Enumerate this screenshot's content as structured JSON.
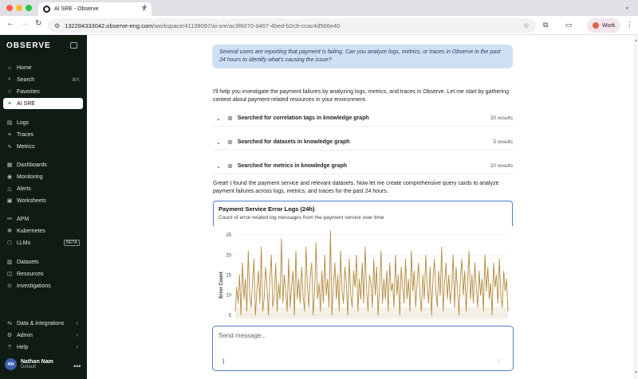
{
  "browser": {
    "tab_title": "AI SRE - Observe",
    "new_tab": "+",
    "url_host": "132284333042.observe-eng.com",
    "url_path": "/workspace/41139097/ai-sre/ac3f6070-d467-4bed-b2c9-ccac4d566e40",
    "profile_label": "Work"
  },
  "sidebar": {
    "logo": "OBSERVE",
    "items": [
      {
        "label": "Home",
        "icon": "home-icon",
        "glyph": "⌂"
      },
      {
        "label": "Search",
        "icon": "search-icon",
        "glyph": "⌕",
        "hint": "⌘K"
      },
      {
        "label": "Favorites",
        "icon": "star-icon",
        "glyph": "☆"
      },
      {
        "label": "AI SRE",
        "icon": "sparkle-icon",
        "glyph": "✦"
      },
      {
        "label": "Logs",
        "icon": "logs-icon",
        "glyph": "▤"
      },
      {
        "label": "Traces",
        "icon": "traces-icon",
        "glyph": "≡"
      },
      {
        "label": "Metrics",
        "icon": "metrics-icon",
        "glyph": "∿"
      },
      {
        "label": "Dashboards",
        "icon": "dashboards-icon",
        "glyph": "▦"
      },
      {
        "label": "Monitoring",
        "icon": "monitoring-icon",
        "glyph": "◉"
      },
      {
        "label": "Alerts",
        "icon": "alerts-icon",
        "glyph": "△"
      },
      {
        "label": "Worksheets",
        "icon": "worksheets-icon",
        "glyph": "▣"
      },
      {
        "label": "APM",
        "icon": "apm-icon",
        "glyph": "⚯"
      },
      {
        "label": "Kubernetes",
        "icon": "kubernetes-icon",
        "glyph": "✻"
      },
      {
        "label": "LLMs",
        "icon": "llm-icon",
        "glyph": "⬡",
        "badge": "BETA"
      },
      {
        "label": "Datasets",
        "icon": "datasets-icon",
        "glyph": "▥"
      },
      {
        "label": "Resources",
        "icon": "resources-icon",
        "glyph": "◫"
      },
      {
        "label": "Investigations",
        "icon": "investigations-icon",
        "glyph": "⊙"
      },
      {
        "label": "Data & integrations",
        "icon": "integrations-icon",
        "glyph": "⇆",
        "arrow": "›"
      },
      {
        "label": "Admin",
        "icon": "admin-icon",
        "glyph": "⚙",
        "arrow": "›"
      },
      {
        "label": "Help",
        "icon": "help-icon",
        "glyph": "?",
        "arrow": "›"
      }
    ],
    "user": {
      "initials": "NN",
      "name": "Nathan Nam",
      "org": "Default"
    }
  },
  "conversation": {
    "user_message": "Several users are reporting that payment is failing. Can you analyze logs, metrics, or traces in Observe in the past 24 hours to identify what's causing the issue?",
    "assistant_intro": "I'll help you investigate the payment failures by analyzing logs, metrics, and traces in Observe. Let me start by gathering context about payment-related resources in your environment.",
    "tool_calls": [
      {
        "label": "Searched for correlation tags in knowledge graph",
        "count": "20 results"
      },
      {
        "label": "Searched for datasets in knowledge graph",
        "count": "5 results"
      },
      {
        "label": "Searched for metrics in knowledge graph",
        "count": "20 results"
      }
    ],
    "assistant_followup": "Great! I found the payment service and relevant datasets. Now let me create comprehensive query cards to analyze payment failures across logs, metrics, and traces for the past 24 hours.",
    "card": {
      "title": "Payment Service Error Logs (24h)",
      "subtitle": "Count of error-related log messages from the payment service over time"
    }
  },
  "composer": {
    "placeholder": "Send message..."
  },
  "chart_data": {
    "type": "line",
    "ylabel": "Error Count",
    "yticks": [
      5,
      10,
      15,
      20,
      25
    ],
    "ylim": [
      3,
      26
    ],
    "color": "#b38a3e",
    "values": [
      6,
      12,
      8,
      15,
      5,
      18,
      9,
      14,
      6,
      21,
      10,
      7,
      13,
      19,
      5,
      11,
      16,
      8,
      22,
      6,
      9,
      17,
      12,
      5,
      14,
      20,
      7,
      10,
      18,
      6,
      13,
      9,
      24,
      8,
      15,
      11,
      6,
      19,
      7,
      12,
      16,
      5,
      21,
      9,
      14,
      8,
      17,
      10,
      6,
      22,
      12,
      7,
      15,
      18,
      5,
      11,
      23,
      9,
      13,
      6,
      16,
      8,
      20,
      10,
      14,
      7,
      26,
      5,
      12,
      18,
      9,
      15,
      6,
      21,
      11,
      8,
      17,
      13,
      5,
      19,
      10,
      7,
      16,
      12,
      20,
      6,
      14,
      9,
      18,
      8,
      22,
      11,
      6,
      15,
      13,
      7,
      19,
      10,
      17,
      5,
      12,
      21,
      8,
      14,
      9,
      16,
      6,
      18,
      11,
      13,
      7,
      20,
      10,
      15,
      5,
      17,
      12,
      8,
      19,
      9,
      14,
      6,
      21,
      11,
      16,
      7,
      13,
      18,
      10,
      6,
      15,
      9,
      20,
      12,
      8,
      17,
      5,
      14,
      19,
      11,
      7,
      16,
      10,
      22,
      6,
      13,
      18,
      9,
      15,
      8,
      12,
      20,
      7,
      17,
      11,
      5,
      14,
      19,
      10,
      16,
      6,
      13,
      21,
      9,
      15,
      8,
      18,
      12,
      7,
      16,
      10,
      14,
      6,
      20,
      11,
      17,
      9,
      13,
      5,
      18,
      12,
      15,
      8,
      19,
      10,
      7,
      16,
      11,
      14,
      6
    ],
    "band_low": 4,
    "band_high": 7
  }
}
